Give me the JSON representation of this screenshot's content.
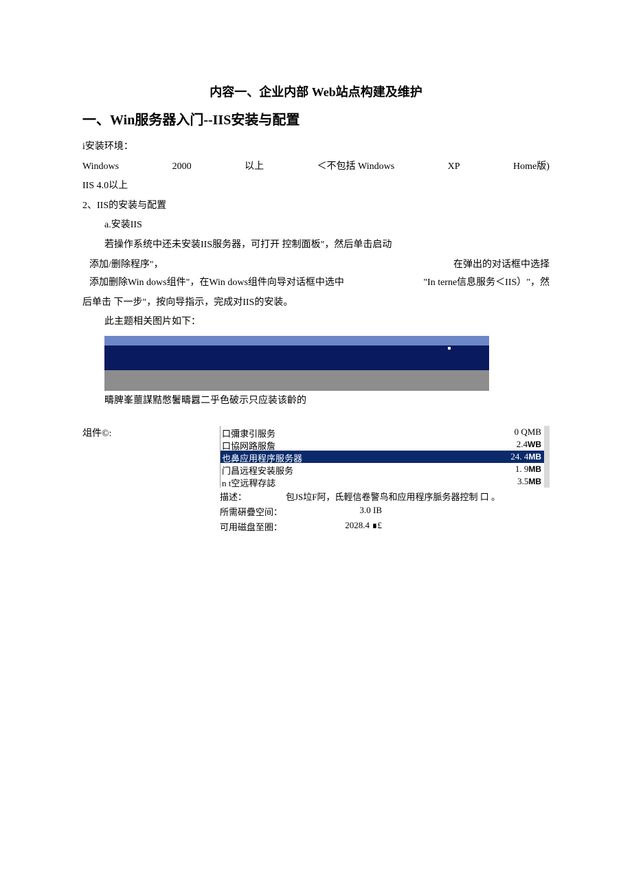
{
  "title_center": "内容一、企业内部 Web站点构建及维护",
  "h1": "一、Win服务器入门--IIS安装与配置",
  "env_label": "i安装环境：",
  "env_row": {
    "c0": "Windows",
    "c1": "2000",
    "c2": "以上",
    "c3": "＜不包括 Windows",
    "c4": "XP",
    "c5": "Home版)"
  },
  "line_iis40": "IIS 4.0以上",
  "line_2": "2、IIS的安装与配置",
  "line_a": "a.安装IIS",
  "line_open": "若操作系统中还未安装IIS服务器，可打开 控制面板\"，然后单击启动",
  "line_add_left": "添加/删除程序\"，",
  "line_add_right": "在弹出的对话框中选择",
  "line_wizard_l": "添加删除Win dows组件\"，在Win dows组件向导对话框中选中",
  "line_wizard_r": "\"In terne信息服务＜IIS）\"，然",
  "line_next": "后单击 下一步\"，按向导指示，完成对IIS的安装。",
  "line_img": "此主题相关图片如下：",
  "gloss_line": "疇脾峯蘁謀黠憋鬐疇囂二乎色破示只应装该齡的",
  "group_label": "俎件©:",
  "components": [
    {
      "name": "口彌隶引服务",
      "size": "0 QMB",
      "sel": false,
      "unit": ""
    },
    {
      "name": "口協网路服詹",
      "size": "2.4",
      "sel": false,
      "unit": "WB"
    },
    {
      "name": "也鼻应用程序服务器",
      "size": "24. 4",
      "sel": true,
      "unit": "MB"
    },
    {
      "name": "门昌远程安装服务",
      "size": "1. 9",
      "sel": false,
      "unit": "MB"
    },
    {
      "name": "n t空远稈存誌",
      "size": "3.5",
      "sel": false,
      "unit": "MB"
    }
  ],
  "desc_label": "描述：",
  "desc_text": "包JS垃F阿，氐輕信卷警鸟和应用程序脈务器控制 口 。",
  "need_label": "所需硏疊空间：",
  "need_val": "3.0 IB",
  "avail_label": "可用磁盘至圈：",
  "avail_val": "2028.4 ∎£"
}
